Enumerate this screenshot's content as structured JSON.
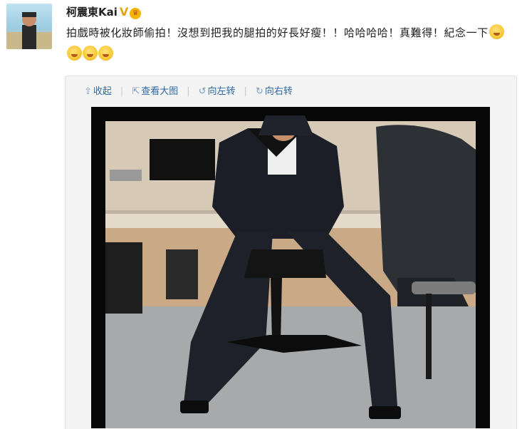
{
  "user": {
    "name": "柯震東Kai",
    "verified_badge": "V"
  },
  "post": {
    "text": "拍戲時被化妝師偷拍！沒想到把我的腿拍的好長好瘦！！哈哈哈哈！真難得！紀念一下",
    "emoji_count": 4
  },
  "toolbar": {
    "collapse": "收起",
    "view_large": "查看大图",
    "rotate_left": "向左转",
    "rotate_right": "向右转"
  },
  "icons": {
    "collapse": "up-arrow-icon",
    "view_large": "external-link-icon",
    "rotate_left": "rotate-left-icon",
    "rotate_right": "rotate-right-icon"
  },
  "colors": {
    "link": "#2d6aa3",
    "badge": "#e3a414"
  }
}
